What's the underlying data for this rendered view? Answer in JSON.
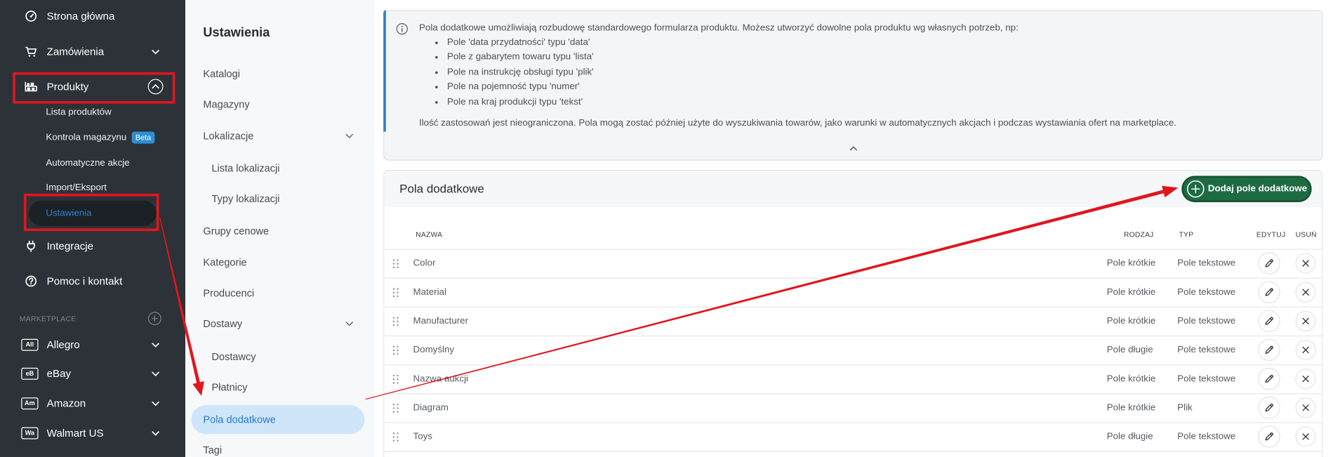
{
  "sidebar": {
    "nav": [
      {
        "label": "Strona główna",
        "icon": "dashboard-icon"
      },
      {
        "label": "Zamówienia",
        "icon": "cart-icon"
      },
      {
        "label": "Produkty",
        "icon": "products-icon"
      },
      {
        "label": "Integracje",
        "icon": "plug-icon"
      },
      {
        "label": "Pomoc i kontakt",
        "icon": "help-icon"
      }
    ],
    "products_submenu": [
      {
        "label": "Lista produktów"
      },
      {
        "label": "Kontrola magazynu",
        "badge": "Beta"
      },
      {
        "label": "Automatyczne akcje"
      },
      {
        "label": "Import/Eksport"
      },
      {
        "label": "Ustawienia",
        "active": true
      }
    ],
    "marketplace_section": "MARKETPLACE",
    "marketplaces": [
      {
        "abbr": "All",
        "label": "Allegro"
      },
      {
        "abbr": "eB",
        "label": "eBay"
      },
      {
        "abbr": "Am",
        "label": "Amazon"
      },
      {
        "abbr": "Wa",
        "label": "Walmart US"
      }
    ]
  },
  "settings_menu": {
    "title": "Ustawienia",
    "items": [
      {
        "label": "Katalogi"
      },
      {
        "label": "Magazyny"
      },
      {
        "label": "Lokalizacje"
      },
      {
        "label": "Lista lokalizacji"
      },
      {
        "label": "Typy lokalizacji"
      },
      {
        "label": "Grupy cenowe"
      },
      {
        "label": "Kategorie"
      },
      {
        "label": "Producenci"
      },
      {
        "label": "Dostawy"
      },
      {
        "label": "Dostawcy"
      },
      {
        "label": "Płatnicy"
      },
      {
        "label": "Pola dodatkowe",
        "active": true
      },
      {
        "label": "Tagi"
      }
    ]
  },
  "info_box": {
    "intro": "Pola dodatkowe umożliwiają rozbudowę standardowego formularza produktu. Możesz utworzyć dowolne pola produktu wg własnych potrzeb, np:",
    "examples": [
      "Pole 'data przydatności' typu 'data'",
      "Pole z gabarytem towaru typu 'lista'",
      "Pole na instrukcję obsługi typu 'plik'",
      "Pole na pojemność typu 'numer'",
      "Pole na kraj produkcji typu 'tekst'"
    ],
    "footer": "Ilość zastosowań jest nieograniczona. Pola mogą zostać później użyte do wyszukiwania towarów, jako warunki w automatycznych akcjach i podczas wystawiania ofert na marketplace."
  },
  "fields_table": {
    "title": "Pola dodatkowe",
    "add_button": "Dodaj pole dodatkowe",
    "columns": {
      "name": "NAZWA",
      "kind": "RODZAJ",
      "type": "TYP",
      "edit": "EDYTUJ",
      "delete": "USUŃ"
    },
    "rows": [
      {
        "name": "Color",
        "kind": "Pole krótkie",
        "type": "Pole tekstowe"
      },
      {
        "name": "Material",
        "kind": "Pole krótkie",
        "type": "Pole tekstowe"
      },
      {
        "name": "Manufacturer",
        "kind": "Pole krótkie",
        "type": "Pole tekstowe"
      },
      {
        "name": "Domyślny",
        "kind": "Pole długie",
        "type": "Pole tekstowe"
      },
      {
        "name": "Nazwa aukcji",
        "kind": "Pole krótkie",
        "type": "Pole tekstowe"
      },
      {
        "name": "Diagram",
        "kind": "Pole krótkie",
        "type": "Plik"
      },
      {
        "name": "Toys",
        "kind": "Pole długie",
        "type": "Pole tekstowe"
      }
    ]
  },
  "colors": {
    "sidebar_bg": "#2c3237",
    "panel_bg": "#f7f8fa",
    "accent_blue": "#2f80d1",
    "active_item_bg": "#cfe5fa",
    "primary_button": "#1e6b43",
    "beta_badge": "#2c8fd6",
    "annotation_red": "#e0161e"
  }
}
